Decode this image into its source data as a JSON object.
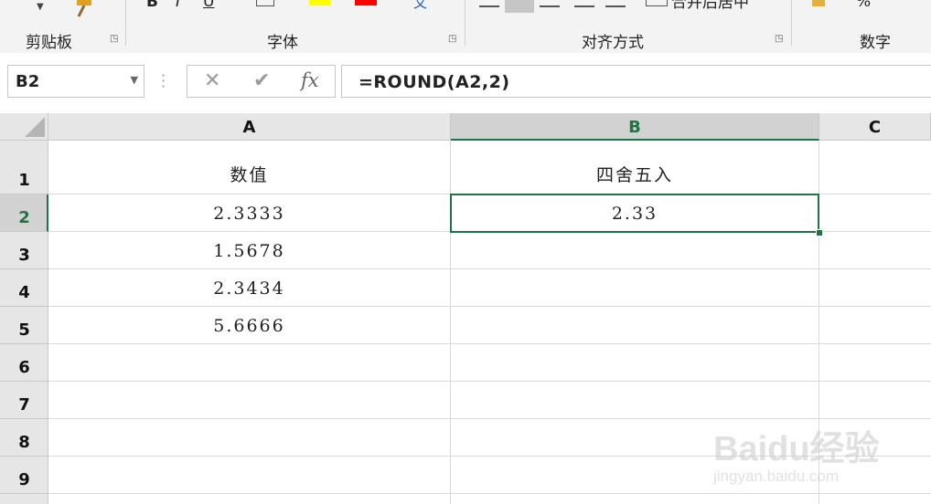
{
  "ribbon": {
    "groups": [
      {
        "label": "剪贴板"
      },
      {
        "label": "字体"
      },
      {
        "label": "对齐方式"
      },
      {
        "label": "数字"
      }
    ],
    "merge_label": "合并后居中",
    "percent_label": "%"
  },
  "formula_bar": {
    "name_box": "B2",
    "formula": "=ROUND(A2,2)",
    "cancel_glyph": "✕",
    "enter_glyph": "✔",
    "fx_label": "fx"
  },
  "columns": [
    "A",
    "B",
    "C"
  ],
  "rows": [
    "1",
    "2",
    "3",
    "4",
    "5",
    "6",
    "7",
    "8",
    "9"
  ],
  "cells": {
    "A1": "数值",
    "B1": "四舍五入",
    "A2": "2.3333",
    "B2": "2.33",
    "A3": "1.5678",
    "A4": "2.3434",
    "A5": "5.6666"
  },
  "selection": {
    "active_cell": "B2",
    "active_column": "B",
    "active_row": "2"
  },
  "colors": {
    "accent": "#217346",
    "header_bg": "#e6e6e6",
    "ribbon_bg": "#f3f3f3"
  },
  "watermark": {
    "main": "Baidu经验",
    "sub": "jingyan.baidu.com"
  }
}
